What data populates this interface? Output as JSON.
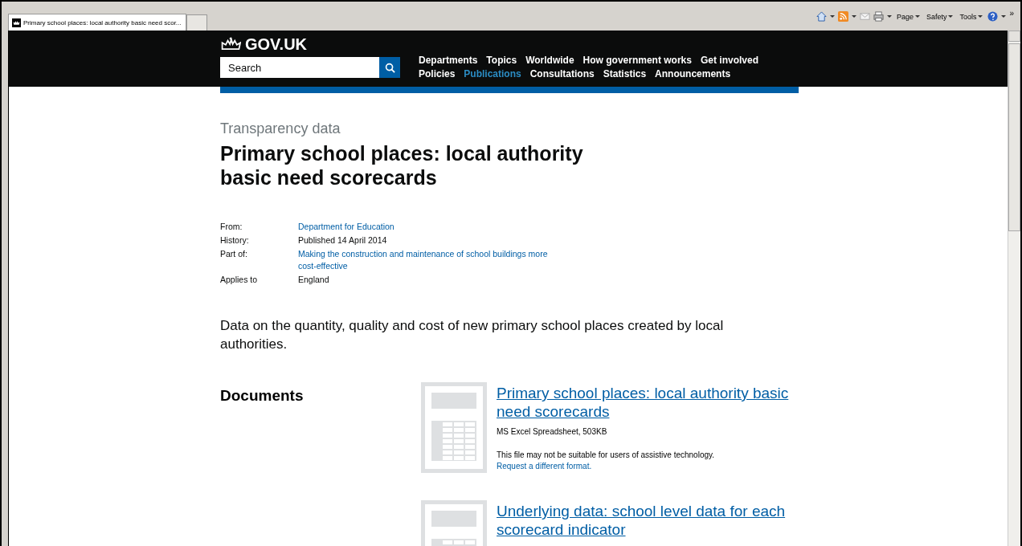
{
  "browser": {
    "tab_title": "Primary school places: local authority basic need scor...",
    "toolbar_menus": [
      "Page",
      "Safety",
      "Tools"
    ],
    "more": "»"
  },
  "header": {
    "logo": "GOV.UK",
    "search": {
      "placeholder": "Search"
    },
    "nav_rows": [
      [
        {
          "label": "Departments",
          "selected": false
        },
        {
          "label": "Topics",
          "selected": false
        },
        {
          "label": "Worldwide",
          "selected": false
        },
        {
          "label": "How government works",
          "selected": false
        },
        {
          "label": "Get involved",
          "selected": false
        }
      ],
      [
        {
          "label": "Policies",
          "selected": false
        },
        {
          "label": "Publications",
          "selected": true
        },
        {
          "label": "Consultations",
          "selected": false
        },
        {
          "label": "Statistics",
          "selected": false
        },
        {
          "label": "Announcements",
          "selected": false
        }
      ]
    ]
  },
  "page": {
    "type": "Transparency data",
    "title": "Primary school places: local authority basic need scorecards",
    "metadata": [
      {
        "label": "From:",
        "value": "Department for Education",
        "kind": "link"
      },
      {
        "label": "History:",
        "value": "Published 14 April 2014",
        "kind": "text"
      },
      {
        "label": "Part of:",
        "value": "Making the construction and maintenance of school buildings more cost-effective",
        "kind": "link"
      },
      {
        "label": "Applies to",
        "value": "England",
        "kind": "text"
      }
    ],
    "summary": "Data on the quantity, quality and cost of new primary school places created by local authorities.",
    "documents_heading": "Documents",
    "documents": [
      {
        "title": "Primary school places: local authority basic need scorecards",
        "format": "MS Excel Spreadsheet, 503KB",
        "note": "This file may not be suitable for users of assistive technology.",
        "request_link": "Request a different format."
      },
      {
        "title": "Underlying data: school level data for each scorecard indicator"
      }
    ]
  }
}
